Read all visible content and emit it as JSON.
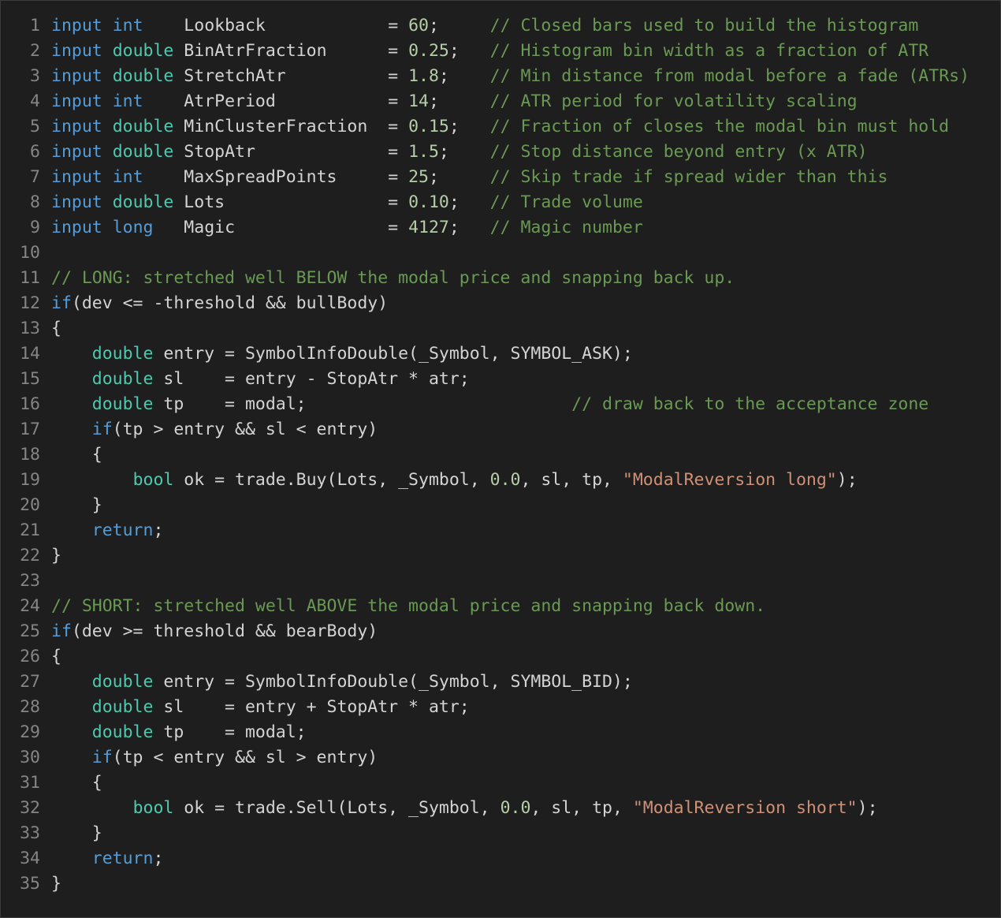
{
  "editor": {
    "lines": [
      {
        "n": "1",
        "tokens": [
          {
            "t": "kw",
            "v": "input"
          },
          {
            "t": "pl",
            "v": " "
          },
          {
            "t": "kw",
            "v": "int"
          },
          {
            "t": "pl",
            "v": "    Lookback            = "
          },
          {
            "t": "num",
            "v": "60"
          },
          {
            "t": "pl",
            "v": ";     "
          },
          {
            "t": "cm",
            "v": "// Closed bars used to build the histogram"
          }
        ]
      },
      {
        "n": "2",
        "tokens": [
          {
            "t": "kw",
            "v": "input"
          },
          {
            "t": "pl",
            "v": " "
          },
          {
            "t": "ty",
            "v": "double"
          },
          {
            "t": "pl",
            "v": " BinAtrFraction      = "
          },
          {
            "t": "num",
            "v": "0.25"
          },
          {
            "t": "pl",
            "v": ";   "
          },
          {
            "t": "cm",
            "v": "// Histogram bin width as a fraction of ATR"
          }
        ]
      },
      {
        "n": "3",
        "tokens": [
          {
            "t": "kw",
            "v": "input"
          },
          {
            "t": "pl",
            "v": " "
          },
          {
            "t": "ty",
            "v": "double"
          },
          {
            "t": "pl",
            "v": " StretchAtr          = "
          },
          {
            "t": "num",
            "v": "1.8"
          },
          {
            "t": "pl",
            "v": ";    "
          },
          {
            "t": "cm",
            "v": "// Min distance from modal before a fade (ATRs)"
          }
        ]
      },
      {
        "n": "4",
        "tokens": [
          {
            "t": "kw",
            "v": "input"
          },
          {
            "t": "pl",
            "v": " "
          },
          {
            "t": "kw",
            "v": "int"
          },
          {
            "t": "pl",
            "v": "    AtrPeriod           = "
          },
          {
            "t": "num",
            "v": "14"
          },
          {
            "t": "pl",
            "v": ";     "
          },
          {
            "t": "cm",
            "v": "// ATR period for volatility scaling"
          }
        ]
      },
      {
        "n": "5",
        "tokens": [
          {
            "t": "kw",
            "v": "input"
          },
          {
            "t": "pl",
            "v": " "
          },
          {
            "t": "ty",
            "v": "double"
          },
          {
            "t": "pl",
            "v": " MinClusterFraction  = "
          },
          {
            "t": "num",
            "v": "0.15"
          },
          {
            "t": "pl",
            "v": ";   "
          },
          {
            "t": "cm",
            "v": "// Fraction of closes the modal bin must hold"
          }
        ]
      },
      {
        "n": "6",
        "tokens": [
          {
            "t": "kw",
            "v": "input"
          },
          {
            "t": "pl",
            "v": " "
          },
          {
            "t": "ty",
            "v": "double"
          },
          {
            "t": "pl",
            "v": " StopAtr             = "
          },
          {
            "t": "num",
            "v": "1.5"
          },
          {
            "t": "pl",
            "v": ";    "
          },
          {
            "t": "cm",
            "v": "// Stop distance beyond entry (x ATR)"
          }
        ]
      },
      {
        "n": "7",
        "tokens": [
          {
            "t": "kw",
            "v": "input"
          },
          {
            "t": "pl",
            "v": " "
          },
          {
            "t": "kw",
            "v": "int"
          },
          {
            "t": "pl",
            "v": "    MaxSpreadPoints     = "
          },
          {
            "t": "num",
            "v": "25"
          },
          {
            "t": "pl",
            "v": ";     "
          },
          {
            "t": "cm",
            "v": "// Skip trade if spread wider than this"
          }
        ]
      },
      {
        "n": "8",
        "tokens": [
          {
            "t": "kw",
            "v": "input"
          },
          {
            "t": "pl",
            "v": " "
          },
          {
            "t": "ty",
            "v": "double"
          },
          {
            "t": "pl",
            "v": " Lots                = "
          },
          {
            "t": "num",
            "v": "0.10"
          },
          {
            "t": "pl",
            "v": ";   "
          },
          {
            "t": "cm",
            "v": "// Trade volume"
          }
        ]
      },
      {
        "n": "9",
        "tokens": [
          {
            "t": "kw",
            "v": "input"
          },
          {
            "t": "pl",
            "v": " "
          },
          {
            "t": "kw",
            "v": "long"
          },
          {
            "t": "pl",
            "v": "   Magic               = "
          },
          {
            "t": "num",
            "v": "4127"
          },
          {
            "t": "pl",
            "v": ";   "
          },
          {
            "t": "cm",
            "v": "// Magic number"
          }
        ]
      },
      {
        "n": "10",
        "tokens": []
      },
      {
        "n": "11",
        "tokens": [
          {
            "t": "cm",
            "v": "// LONG: stretched well BELOW the modal price and snapping back up."
          }
        ]
      },
      {
        "n": "12",
        "tokens": [
          {
            "t": "kw",
            "v": "if"
          },
          {
            "t": "pl",
            "v": "(dev <= -threshold && bullBody)"
          }
        ]
      },
      {
        "n": "13",
        "tokens": [
          {
            "t": "pl",
            "v": "{"
          }
        ]
      },
      {
        "n": "14",
        "tokens": [
          {
            "t": "pl",
            "v": "    "
          },
          {
            "t": "ty",
            "v": "double"
          },
          {
            "t": "pl",
            "v": " entry = SymbolInfoDouble(_Symbol, SYMBOL_ASK);"
          }
        ]
      },
      {
        "n": "15",
        "tokens": [
          {
            "t": "pl",
            "v": "    "
          },
          {
            "t": "ty",
            "v": "double"
          },
          {
            "t": "pl",
            "v": " sl    = entry - StopAtr * atr;"
          }
        ]
      },
      {
        "n": "16",
        "tokens": [
          {
            "t": "pl",
            "v": "    "
          },
          {
            "t": "ty",
            "v": "double"
          },
          {
            "t": "pl",
            "v": " tp    = modal;                          "
          },
          {
            "t": "cm",
            "v": "// draw back to the acceptance zone"
          }
        ]
      },
      {
        "n": "17",
        "tokens": [
          {
            "t": "pl",
            "v": "    "
          },
          {
            "t": "kw",
            "v": "if"
          },
          {
            "t": "pl",
            "v": "(tp > entry && sl < entry)"
          }
        ]
      },
      {
        "n": "18",
        "tokens": [
          {
            "t": "pl",
            "v": "    {"
          }
        ]
      },
      {
        "n": "19",
        "tokens": [
          {
            "t": "pl",
            "v": "        "
          },
          {
            "t": "ty",
            "v": "bool"
          },
          {
            "t": "pl",
            "v": " ok = trade.Buy(Lots, _Symbol, "
          },
          {
            "t": "num",
            "v": "0.0"
          },
          {
            "t": "pl",
            "v": ", sl, tp, "
          },
          {
            "t": "str",
            "v": "\"ModalReversion long\""
          },
          {
            "t": "pl",
            "v": ");"
          }
        ]
      },
      {
        "n": "20",
        "tokens": [
          {
            "t": "pl",
            "v": "    }"
          }
        ]
      },
      {
        "n": "21",
        "tokens": [
          {
            "t": "pl",
            "v": "    "
          },
          {
            "t": "kw",
            "v": "return"
          },
          {
            "t": "pl",
            "v": ";"
          }
        ]
      },
      {
        "n": "22",
        "tokens": [
          {
            "t": "pl",
            "v": "}"
          }
        ]
      },
      {
        "n": "23",
        "tokens": []
      },
      {
        "n": "24",
        "tokens": [
          {
            "t": "cm",
            "v": "// SHORT: stretched well ABOVE the modal price and snapping back down."
          }
        ]
      },
      {
        "n": "25",
        "tokens": [
          {
            "t": "kw",
            "v": "if"
          },
          {
            "t": "pl",
            "v": "(dev >= threshold && bearBody)"
          }
        ]
      },
      {
        "n": "26",
        "tokens": [
          {
            "t": "pl",
            "v": "{"
          }
        ]
      },
      {
        "n": "27",
        "tokens": [
          {
            "t": "pl",
            "v": "    "
          },
          {
            "t": "ty",
            "v": "double"
          },
          {
            "t": "pl",
            "v": " entry = SymbolInfoDouble(_Symbol, SYMBOL_BID);"
          }
        ]
      },
      {
        "n": "28",
        "tokens": [
          {
            "t": "pl",
            "v": "    "
          },
          {
            "t": "ty",
            "v": "double"
          },
          {
            "t": "pl",
            "v": " sl    = entry + StopAtr * atr;"
          }
        ]
      },
      {
        "n": "29",
        "tokens": [
          {
            "t": "pl",
            "v": "    "
          },
          {
            "t": "ty",
            "v": "double"
          },
          {
            "t": "pl",
            "v": " tp    = modal;"
          }
        ]
      },
      {
        "n": "30",
        "tokens": [
          {
            "t": "pl",
            "v": "    "
          },
          {
            "t": "kw",
            "v": "if"
          },
          {
            "t": "pl",
            "v": "(tp < entry && sl > entry)"
          }
        ]
      },
      {
        "n": "31",
        "tokens": [
          {
            "t": "pl",
            "v": "    {"
          }
        ]
      },
      {
        "n": "32",
        "tokens": [
          {
            "t": "pl",
            "v": "        "
          },
          {
            "t": "ty",
            "v": "bool"
          },
          {
            "t": "pl",
            "v": " ok = trade.Sell(Lots, _Symbol, "
          },
          {
            "t": "num",
            "v": "0.0"
          },
          {
            "t": "pl",
            "v": ", sl, tp, "
          },
          {
            "t": "str",
            "v": "\"ModalReversion short\""
          },
          {
            "t": "pl",
            "v": ");"
          }
        ]
      },
      {
        "n": "33",
        "tokens": [
          {
            "t": "pl",
            "v": "    }"
          }
        ]
      },
      {
        "n": "34",
        "tokens": [
          {
            "t": "pl",
            "v": "    "
          },
          {
            "t": "kw",
            "v": "return"
          },
          {
            "t": "pl",
            "v": ";"
          }
        ]
      },
      {
        "n": "35",
        "tokens": [
          {
            "t": "pl",
            "v": "}"
          }
        ]
      }
    ]
  },
  "colors": {
    "background": "#1e1e1e",
    "line_number": "#858585",
    "keyword": "#569cd6",
    "type": "#4ec9b0",
    "number": "#b5cea8",
    "string": "#ce9178",
    "comment": "#6a9955",
    "text": "#d4d4d4"
  }
}
